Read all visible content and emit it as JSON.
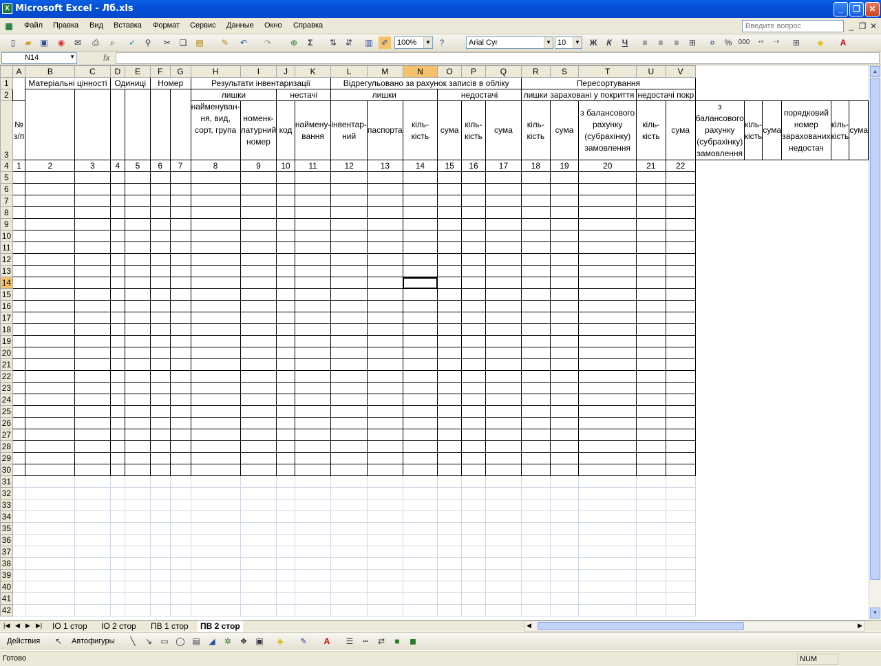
{
  "window": {
    "title": "Microsoft Excel - Лб.xls",
    "minimize": "_",
    "restore": "❐",
    "close": "✕"
  },
  "menu": {
    "items": [
      "Файл",
      "Правка",
      "Вид",
      "Вставка",
      "Формат",
      "Сервис",
      "Данные",
      "Окно",
      "Справка"
    ],
    "ask_placeholder": "Введите вопрос"
  },
  "toolbar": {
    "zoom": "100%",
    "font": "Arial Cyr",
    "font_size": "10",
    "bold": "Ж",
    "italic": "К",
    "underline": "Ч",
    "percent": "%",
    "thousands": "000",
    "font_color_label": "A"
  },
  "formula": {
    "cell_ref": "N14",
    "fx": "fx",
    "value": ""
  },
  "columns": [
    "A",
    "B",
    "C",
    "D",
    "E",
    "F",
    "G",
    "H",
    "I",
    "J",
    "K",
    "L",
    "M",
    "N",
    "O",
    "P",
    "Q",
    "R",
    "S",
    "T",
    "U",
    "V"
  ],
  "selected_column": "N",
  "selected_row": 14,
  "header": {
    "r1": {
      "b_c": "Матеріальні цінності",
      "d_e": "Одиниці",
      "f_g": "Номер",
      "h_k": "Результати інвентаризації",
      "l_q": "Відрегульовано за рахунок записів в обліку",
      "r_v": "Пересортування"
    },
    "r2": {
      "h_i": "лишки",
      "j_k": "нестачі",
      "l_n": "лишки",
      "o_q": "недостачі",
      "r_t": "лишки зараховані у покриття",
      "u_v": "недостачі покр"
    },
    "r3": {
      "a": "№ з/п",
      "b": "найменуван-ня, вид, сорт, група",
      "c": "номенк-латурний номер",
      "d": "код",
      "e": "наймену-вання",
      "f": "інвентар-ний",
      "g": "паспорта",
      "h": "кіль-кість",
      "i": "сума",
      "j": "кіль-кість",
      "k": "сума",
      "l": "кіль-кість",
      "m": "сума",
      "n": "з балансового рахунку (субрахінку) замовлення",
      "o": "кіль-кість",
      "p": "сума",
      "q": "з балансового рахунку (субрахінку) замовлення",
      "r": "кіль-кість",
      "s": "сума",
      "t": "порядковий номер зарахованих недостач",
      "u": "кіль-кість",
      "v": "сума"
    },
    "r4": [
      "1",
      "2",
      "3",
      "4",
      "5",
      "6",
      "7",
      "8",
      "9",
      "10",
      "11",
      "12",
      "13",
      "14",
      "15",
      "16",
      "17",
      "18",
      "19",
      "20",
      "21",
      "22"
    ]
  },
  "sheet_tabs": [
    "ІО 1 стор",
    "ІО 2 стор",
    "ПВ 1 стор",
    "ПВ 2 стор"
  ],
  "active_tab": "ПВ 2 стор",
  "drawing": {
    "actions": "Действия",
    "autoshapes": "Автофигуры"
  },
  "status": {
    "text": "Готово",
    "num": "NUM"
  }
}
